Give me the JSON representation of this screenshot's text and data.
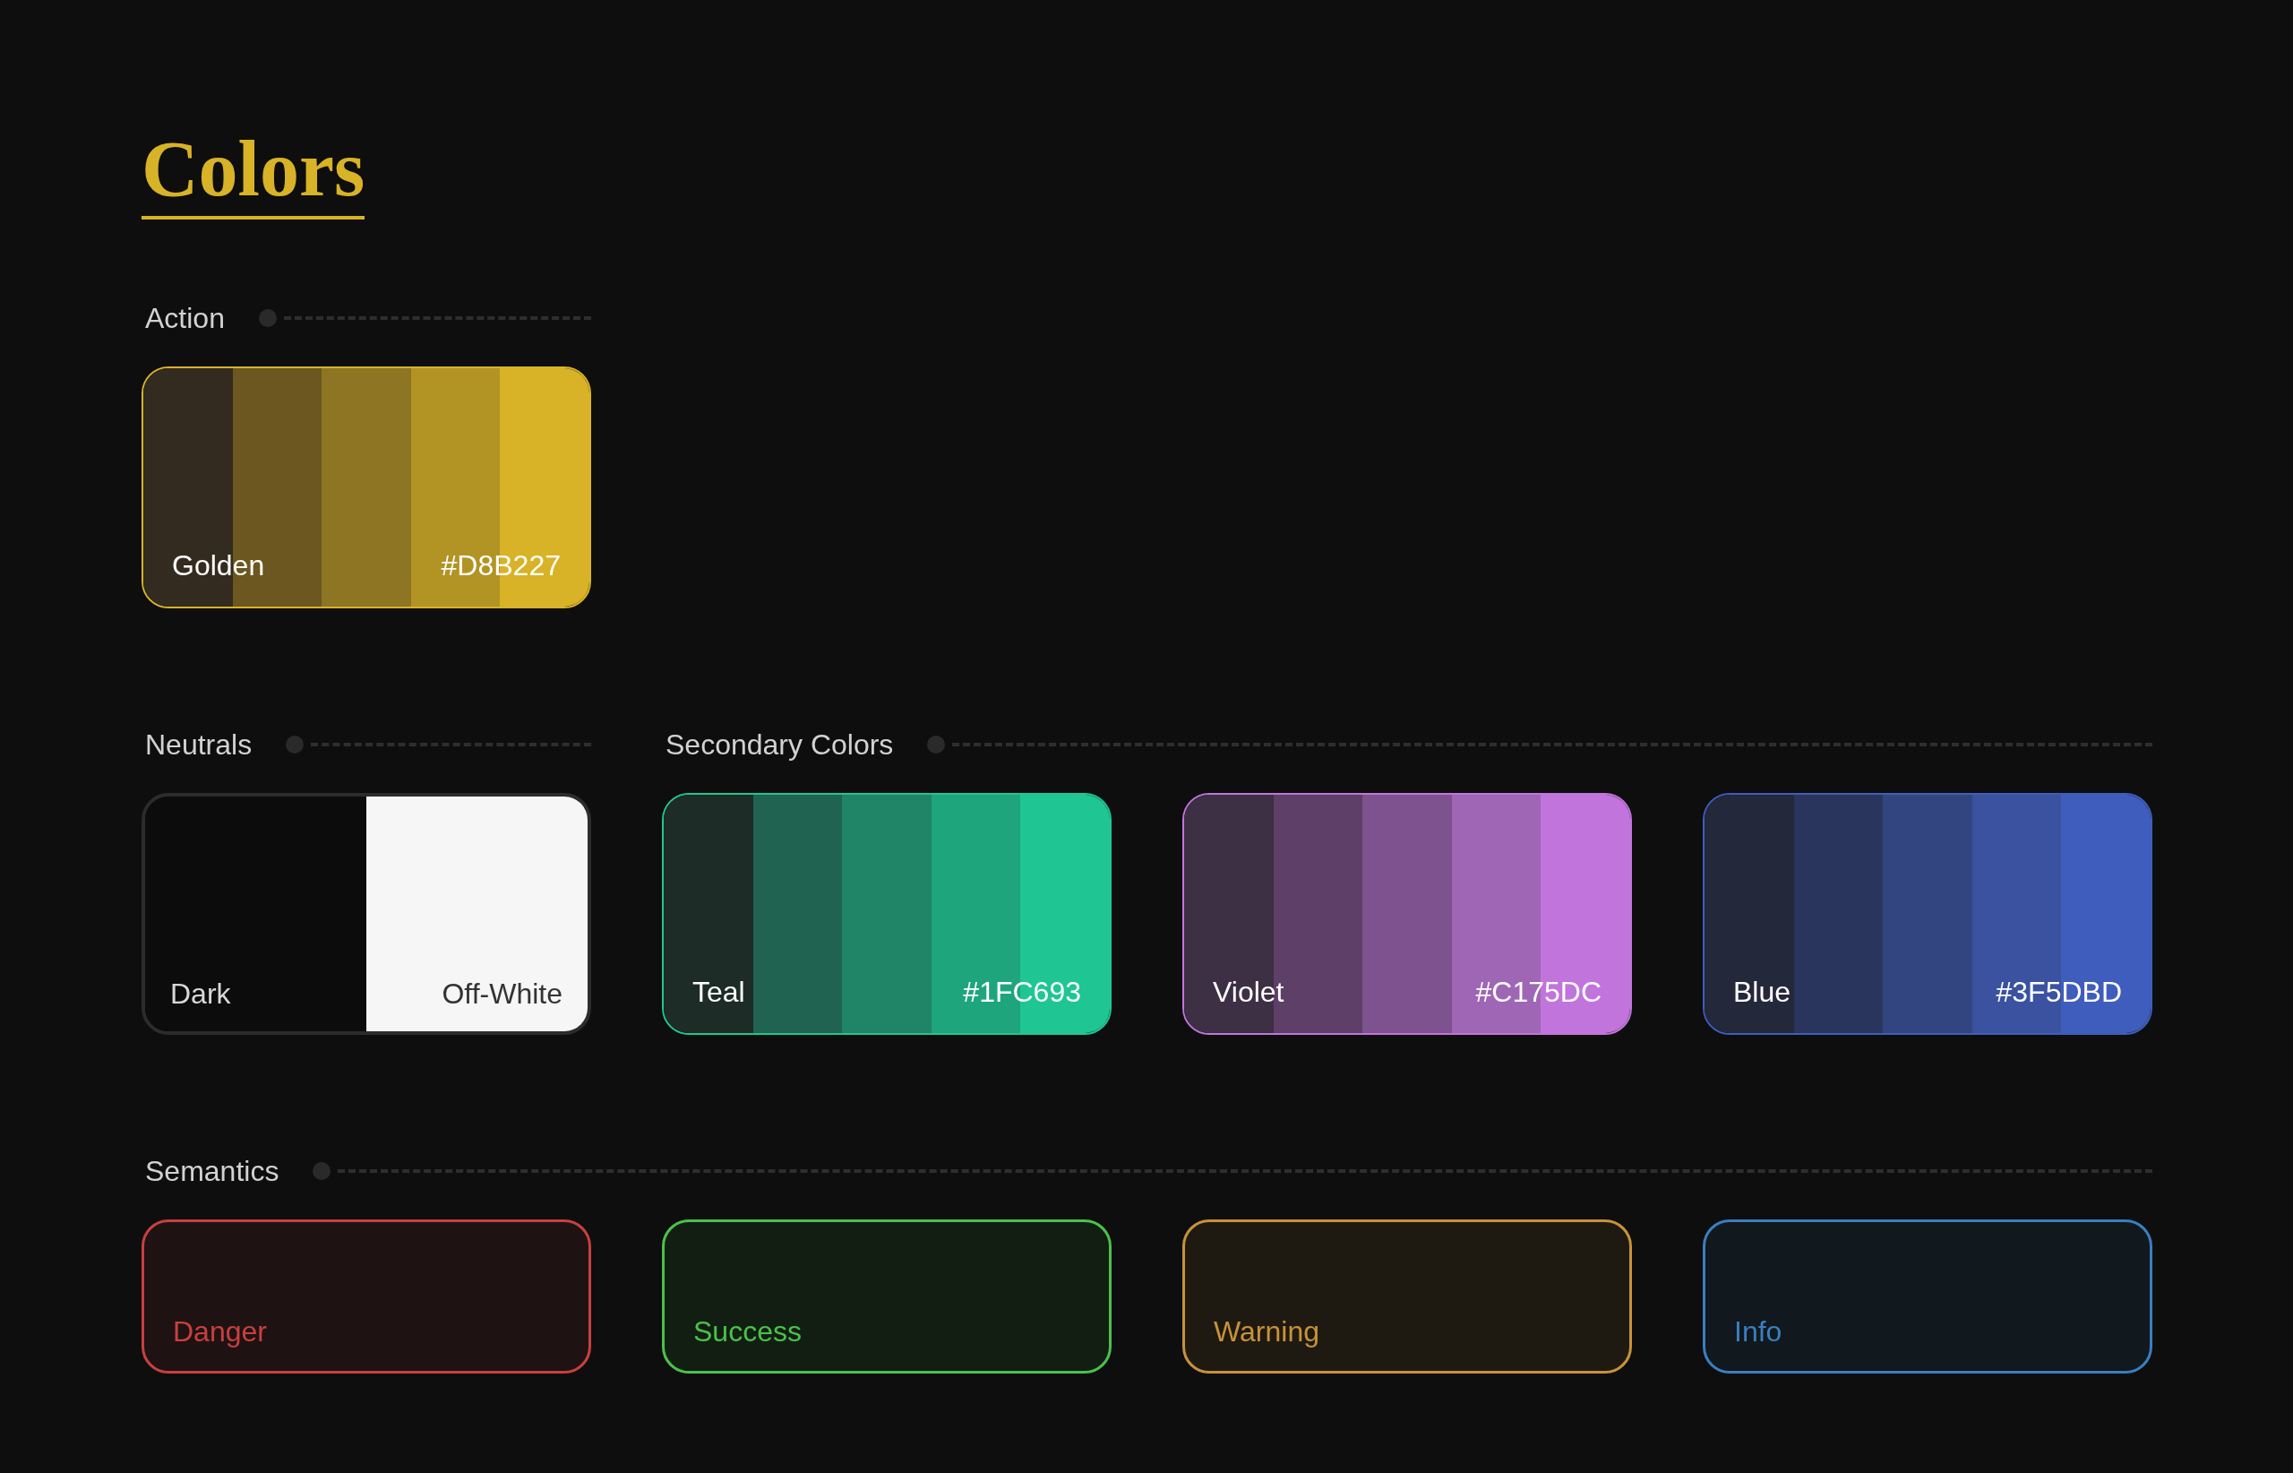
{
  "title": "Colors",
  "rows": [
    [
      {
        "label": "Action",
        "cards": [
          {
            "kind": "palette",
            "name": "Golden",
            "hex": "#D8B227",
            "color": "#d8b227",
            "shades": [
              {
                "color": "#332b1f"
              },
              {
                "color": "#6b571f"
              },
              {
                "color": "#8d7523"
              },
              {
                "color": "#b29424"
              },
              {
                "color": "#d8b227"
              }
            ]
          }
        ]
      }
    ],
    [
      {
        "label": "Neutrals",
        "cards": [
          {
            "kind": "split",
            "color": "#2c2c2c",
            "halves": [
              {
                "label": "Dark",
                "color": "#0c0c0c"
              },
              {
                "label": "Off-White",
                "color": "#f6f6f6"
              }
            ]
          }
        ]
      },
      {
        "label": "Secondary Colors",
        "cards": [
          {
            "kind": "palette",
            "name": "Teal",
            "hex": "#1FC693",
            "color": "#1fc693",
            "shades": [
              {
                "color": "#1e2c27"
              },
              {
                "color": "#1f6350"
              },
              {
                "color": "#208566"
              },
              {
                "color": "#1fa57c"
              },
              {
                "color": "#1fc693"
              }
            ]
          },
          {
            "kind": "palette",
            "name": "Violet",
            "hex": "#C175DC",
            "color": "#c175dc",
            "shades": [
              {
                "color": "#3d2f44"
              },
              {
                "color": "#5d3f68"
              },
              {
                "color": "#7d528e"
              },
              {
                "color": "#9f66b5"
              },
              {
                "color": "#c175dc"
              }
            ]
          },
          {
            "kind": "palette",
            "name": "Blue",
            "hex": "#3F5DBD",
            "color": "#3f5dbd",
            "shades": [
              {
                "color": "#24283b"
              },
              {
                "color": "#2a355e"
              },
              {
                "color": "#334580"
              },
              {
                "color": "#3a52a0"
              },
              {
                "color": "#3f5dbd"
              }
            ]
          }
        ]
      }
    ],
    [
      {
        "label": "Semantics",
        "cards": [
          {
            "kind": "semantic",
            "name": "Danger",
            "color": "#c8403f"
          },
          {
            "kind": "semantic",
            "name": "Success",
            "color": "#4ac24a"
          },
          {
            "kind": "semantic",
            "name": "Warning",
            "color": "#c8923a"
          },
          {
            "kind": "semantic",
            "name": "Info",
            "color": "#3a7fc0"
          }
        ]
      }
    ]
  ]
}
